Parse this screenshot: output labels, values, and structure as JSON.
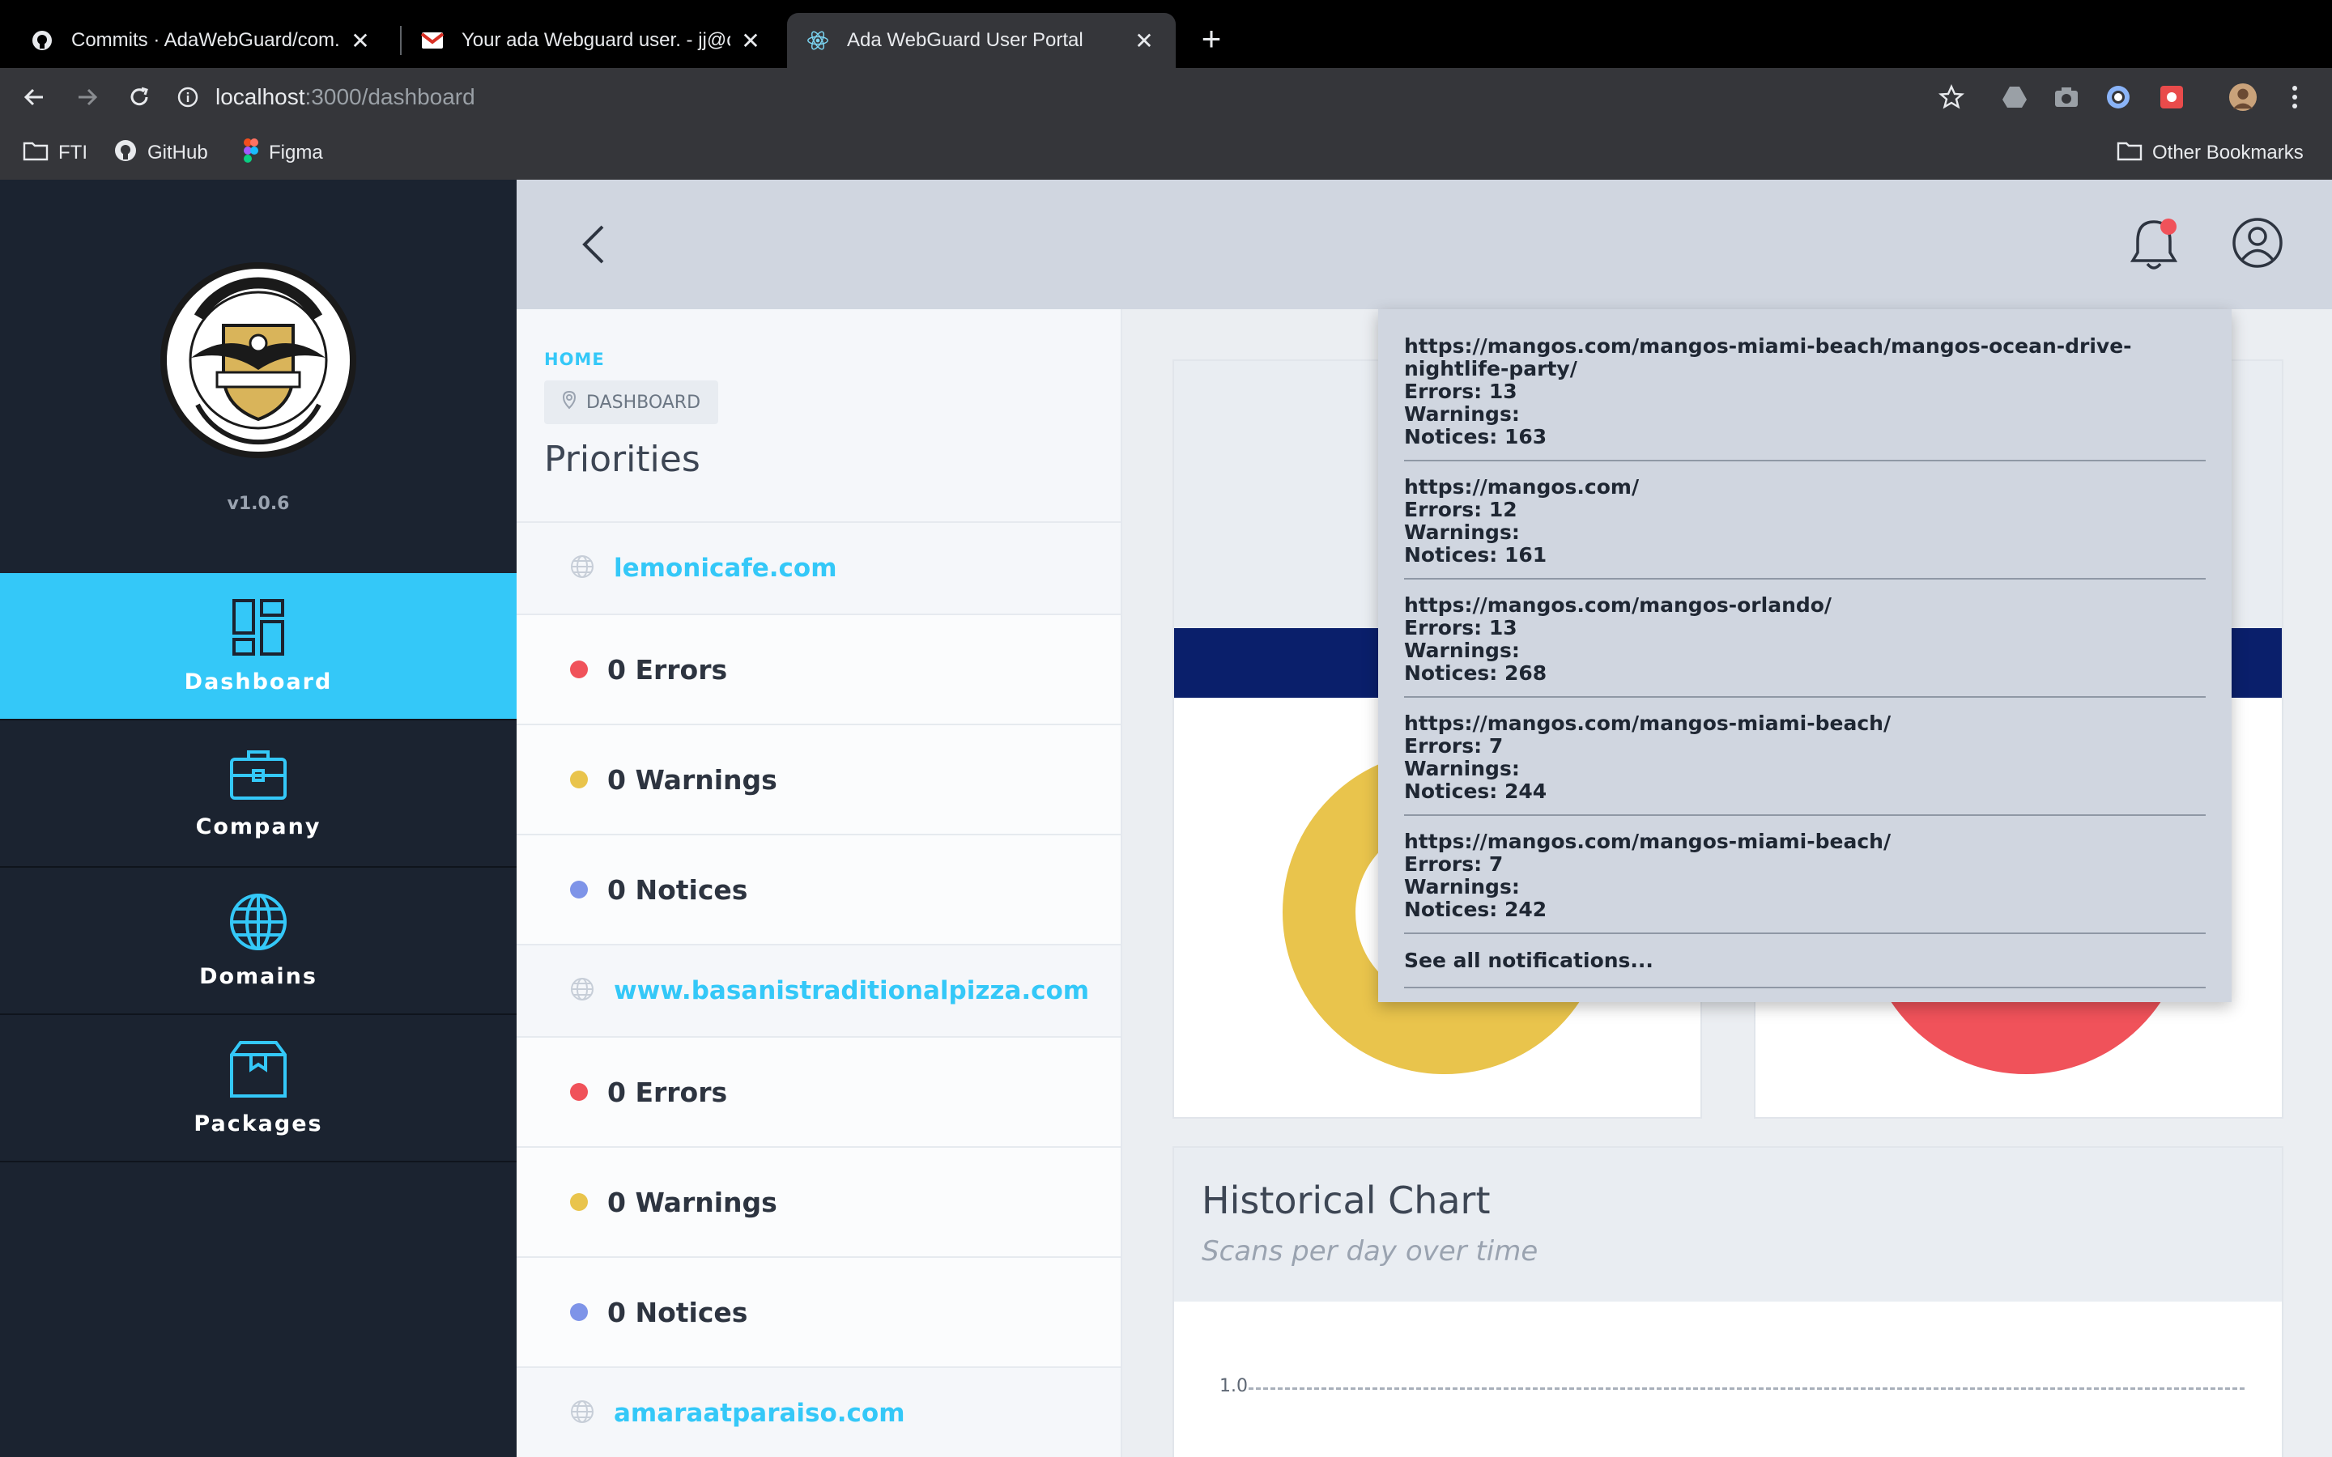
{
  "browser": {
    "tabs": [
      {
        "title": "Commits · AdaWebGuard/com.ad",
        "favicon": "github-icon"
      },
      {
        "title": "Your ada Webguard user. - jj@cn",
        "favicon": "gmail-icon"
      },
      {
        "title": "Ada WebGuard User Portal",
        "favicon": "react-icon"
      }
    ],
    "url_host": "localhost",
    "url_path": ":3000/dashboard",
    "bookmarks": [
      "FTI",
      "GitHub",
      "Figma"
    ],
    "other_bookmarks": "Other Bookmarks"
  },
  "sidebar": {
    "version": "v1.0.6",
    "nav": [
      {
        "label": "Dashboard",
        "icon": "dashboard-icon",
        "active": true
      },
      {
        "label": "Company",
        "icon": "briefcase-icon",
        "active": false
      },
      {
        "label": "Domains",
        "icon": "globe-icon",
        "active": false
      },
      {
        "label": "Packages",
        "icon": "package-icon",
        "active": false
      }
    ]
  },
  "breadcrumb": {
    "home": "HOME",
    "current": "DASHBOARD"
  },
  "priorities": {
    "title": "Priorities",
    "domains": [
      {
        "name": "lemonicafe.com",
        "errors": "0 Errors",
        "warnings": "0 Warnings",
        "notices": "0 Notices"
      },
      {
        "name": "www.basanistraditionalpizza.com",
        "errors": "0 Errors",
        "warnings": "0 Warnings",
        "notices": "0 Notices"
      },
      {
        "name": "amaraatparaiso.com"
      }
    ]
  },
  "colors": {
    "accent": "#34c8f8",
    "error": "#f0525a",
    "warning": "#e9c44c",
    "notice": "#7e94e8",
    "sidebar_bg": "#1b2330",
    "band": "#0a1f6b"
  },
  "notifications": {
    "items": [
      {
        "url": "https://mangos.com/mangos-miami-beach/mangos-ocean-drive-nightlife-party/",
        "errors": "Errors: 13",
        "warnings": "Warnings:",
        "notices": "Notices: 163"
      },
      {
        "url": "https://mangos.com/",
        "errors": "Errors: 12",
        "warnings": "Warnings:",
        "notices": "Notices: 161"
      },
      {
        "url": "https://mangos.com/mangos-orlando/",
        "errors": "Errors: 13",
        "warnings": "Warnings:",
        "notices": "Notices: 268"
      },
      {
        "url": "https://mangos.com/mangos-miami-beach/",
        "errors": "Errors: 7",
        "warnings": "Warnings:",
        "notices": "Notices: 244"
      },
      {
        "url": "https://mangos.com/mangos-miami-beach/",
        "errors": "Errors: 7",
        "warnings": "Warnings:",
        "notices": "Notices: 242"
      }
    ],
    "see_all": "See all notifications..."
  },
  "historical": {
    "title": "Historical Chart",
    "subtitle": "Scans per day over time",
    "y_tick": "1.0"
  }
}
